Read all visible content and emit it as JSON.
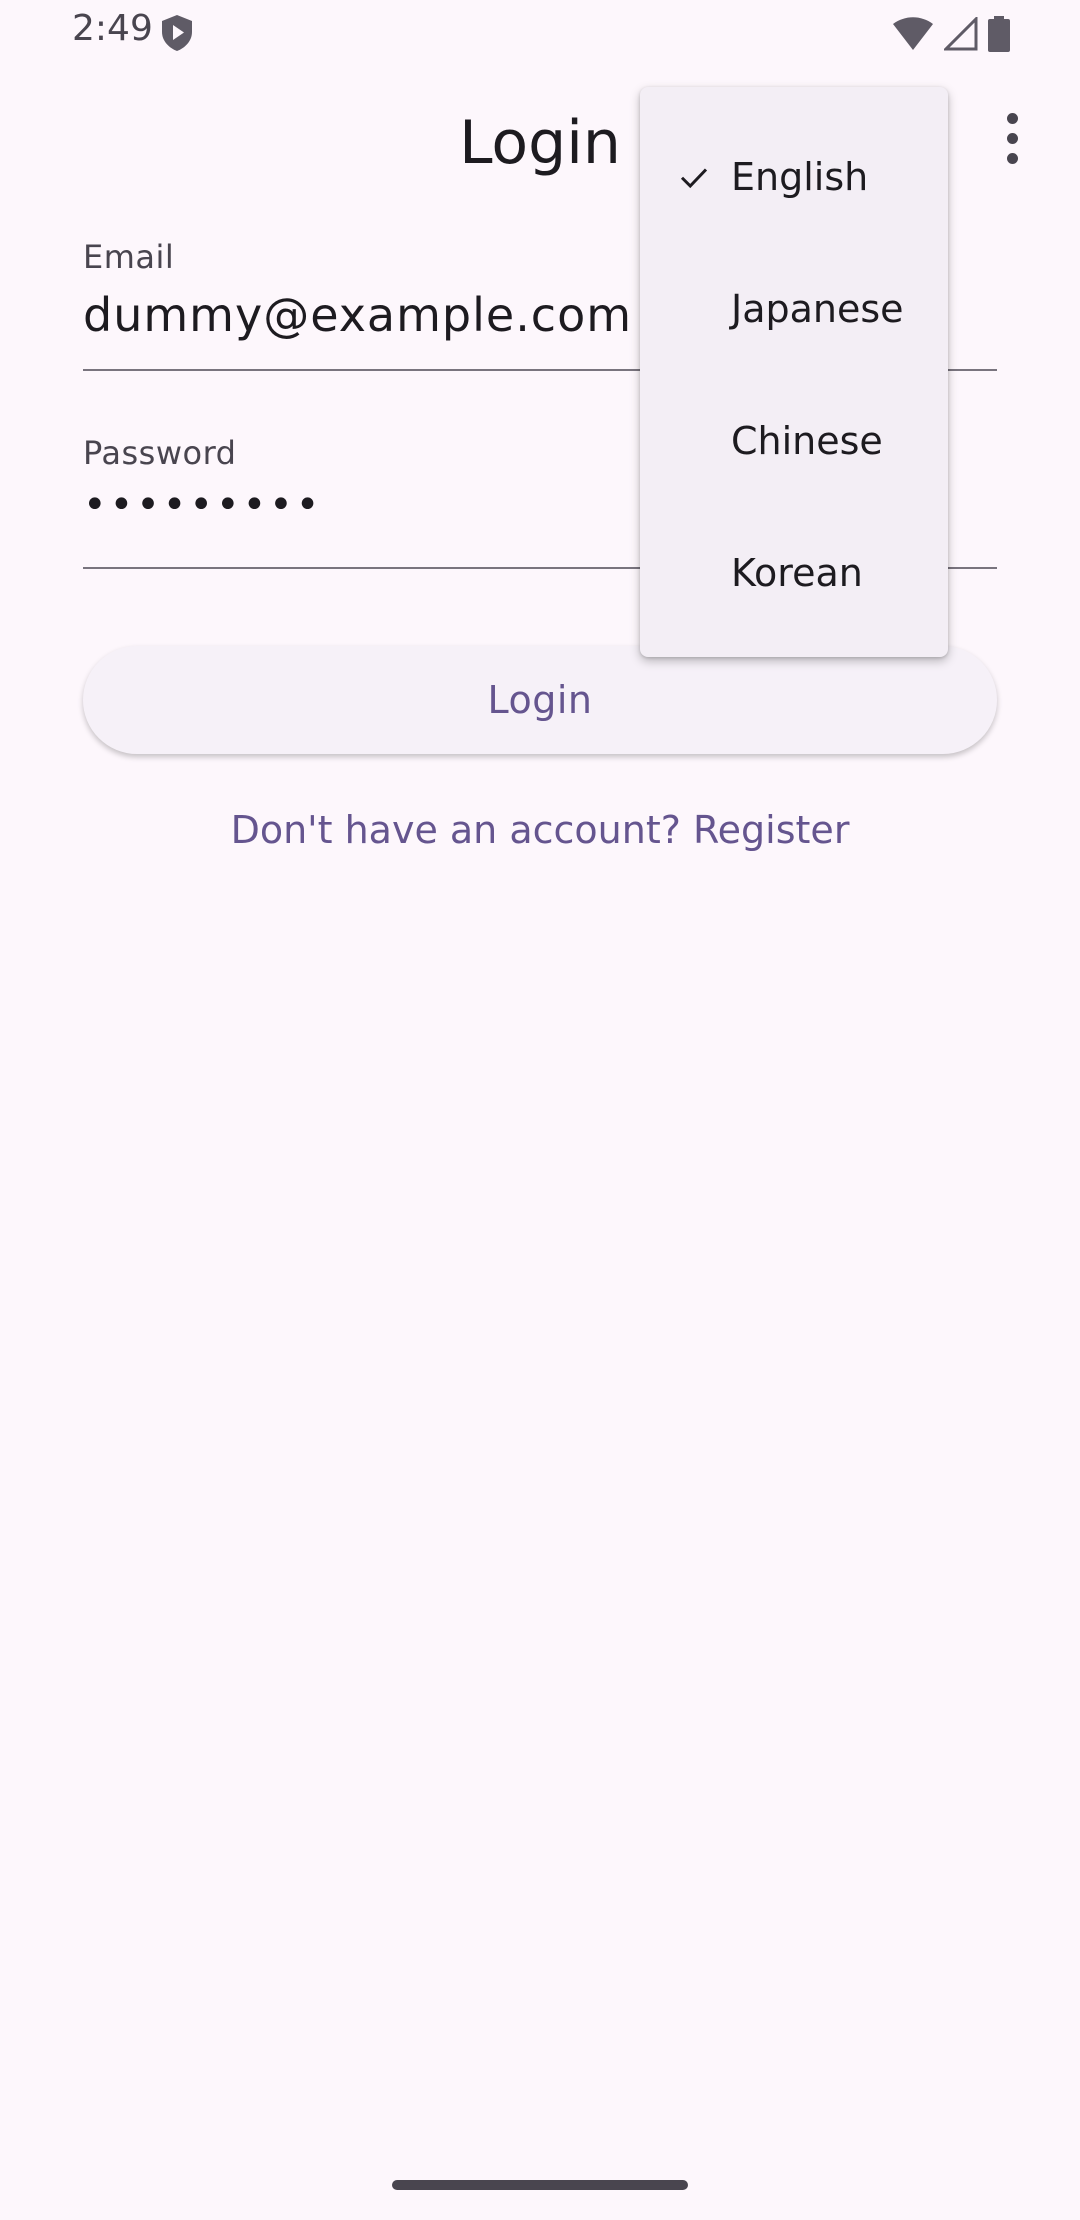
{
  "status_bar": {
    "time": "2:49",
    "icons": [
      "shield-play-icon",
      "wifi-icon",
      "cellular-signal-icon",
      "battery-icon"
    ]
  },
  "app_bar": {
    "title": "Login",
    "more_icon": "more-vertical-icon"
  },
  "form": {
    "email": {
      "label": "Email",
      "value": "dummy@example.com"
    },
    "password": {
      "label": "Password",
      "value": "•••••••••"
    },
    "login_button": "Login",
    "register_link": "Don't have an account? Register"
  },
  "language_menu": {
    "selected": "English",
    "items": [
      {
        "label": "English",
        "checked": true
      },
      {
        "label": "Japanese",
        "checked": false
      },
      {
        "label": "Chinese",
        "checked": false
      },
      {
        "label": "Korean",
        "checked": false
      }
    ]
  },
  "colors": {
    "background": "#fdf7fc",
    "primary": "#65558f",
    "menu_surface": "#f3eef5",
    "button_surface": "#f6f1f8",
    "on_surface": "#1d1b20",
    "on_surface_variant": "#49454f"
  }
}
